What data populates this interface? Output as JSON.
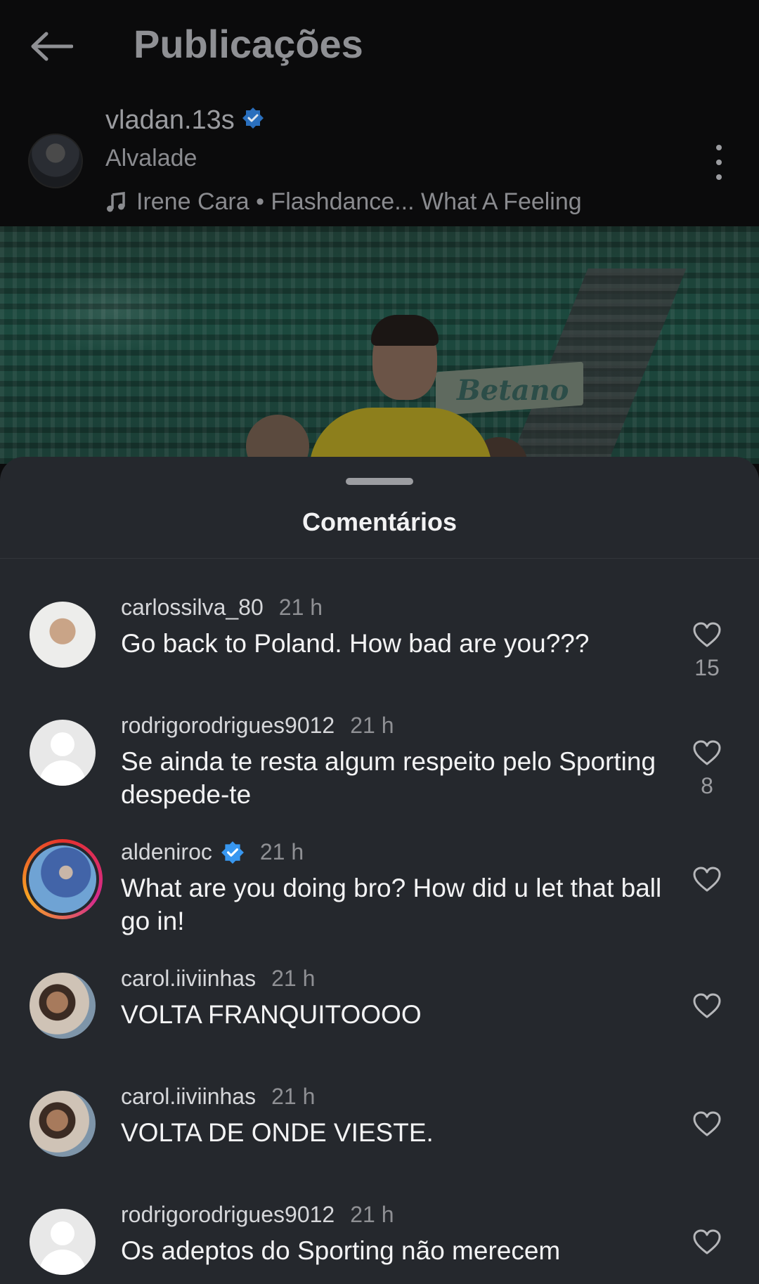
{
  "header": {
    "title": "Publicações",
    "back_icon": "arrow-left-icon"
  },
  "post": {
    "username": "vladan.13s",
    "verified": true,
    "location": "Alvalade",
    "music": "Irene Cara • Flashdance... What A Feeling",
    "image_banner_text": "Betano"
  },
  "comments_sheet": {
    "title": "Comentários",
    "comments": [
      {
        "user": "carlossilva_80",
        "verified": false,
        "time": "21 h",
        "text": "Go back to Poland. How bad are you???",
        "likes": "15",
        "avatar": "photo"
      },
      {
        "user": "rodrigorodrigues9012",
        "verified": false,
        "time": "21 h",
        "text": "Se ainda te resta algum respeito pelo Sporting despede-te",
        "likes": "8",
        "avatar": "default"
      },
      {
        "user": "aldeniroc",
        "verified": true,
        "time": "21 h",
        "text": "What are you doing bro? How did u let that ball go in!",
        "likes": "",
        "avatar": "story-ring"
      },
      {
        "user": "carol.iiviinhas",
        "verified": false,
        "time": "21 h",
        "text": "VOLTA FRANQUITOOOO",
        "likes": "",
        "avatar": "photo"
      },
      {
        "user": "carol.iiviinhas",
        "verified": false,
        "time": "21 h",
        "text": "VOLTA DE ONDE VIESTE.",
        "likes": "",
        "avatar": "photo"
      },
      {
        "user": "rodrigorodrigues9012",
        "verified": false,
        "time": "21 h",
        "text": "Os adeptos do Sporting não merecem",
        "likes": "",
        "avatar": "default"
      }
    ]
  },
  "colors": {
    "sheet_bg": "#25282d",
    "verified_blue": "#3897f0",
    "background": "#0b0b0c"
  }
}
